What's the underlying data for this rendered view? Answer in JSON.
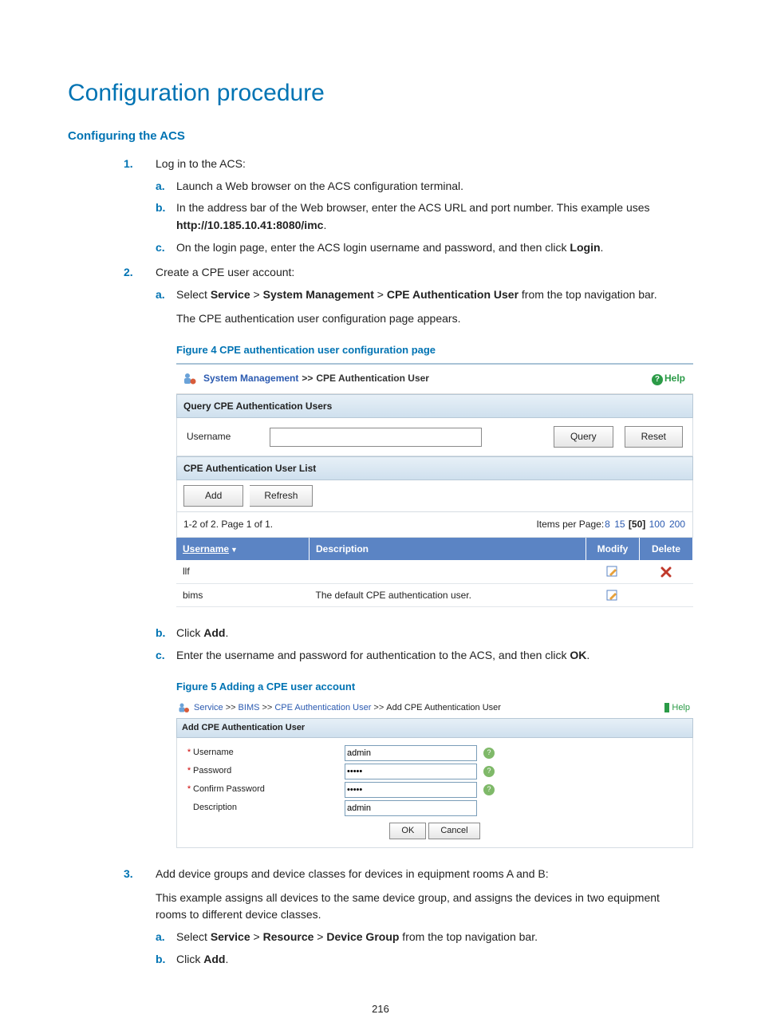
{
  "title": "Configuration procedure",
  "section1": "Configuring the ACS",
  "step1": {
    "num": "1.",
    "text": "Log in to the ACS:",
    "a": {
      "sub": "a.",
      "text": "Launch a Web browser on the ACS configuration terminal."
    },
    "b": {
      "sub": "b.",
      "pre": "In the address bar of the Web browser, enter the ACS URL and port number. This example uses ",
      "bold": "http://10.185.10.41:8080/imc",
      "post": "."
    },
    "c": {
      "sub": "c.",
      "pre": "On the login page, enter the ACS login username and password, and then click ",
      "bold": "Login",
      "post": "."
    }
  },
  "step2": {
    "num": "2.",
    "text": "Create a CPE user account:",
    "a": {
      "sub": "a.",
      "pre": "Select ",
      "b1": "Service",
      "gt1": " > ",
      "b2": "System Management",
      "gt2": " > ",
      "b3": "CPE Authentication User",
      "post": " from the top navigation bar.",
      "after": "The CPE authentication user configuration page appears."
    },
    "fig4cap": "Figure 4 CPE authentication user configuration page",
    "b": {
      "sub": "b.",
      "pre": "Click ",
      "bold": "Add",
      "post": "."
    },
    "c": {
      "sub": "c.",
      "pre": "Enter the username and password for authentication to the ACS, and then click ",
      "bold": "OK",
      "post": "."
    },
    "fig5cap": "Figure 5 Adding a CPE user account"
  },
  "step3": {
    "num": "3.",
    "text": "Add device groups and device classes for devices in equipment rooms A and B:",
    "after": "This example assigns all devices to the same device group, and assigns the devices in two equipment rooms to different device classes.",
    "a": {
      "sub": "a.",
      "pre": "Select ",
      "b1": "Service",
      "gt1": " > ",
      "b2": "Resource",
      "gt2": " > ",
      "b3": "Device Group",
      "post": " from the top navigation bar."
    },
    "b": {
      "sub": "b.",
      "pre": "Click ",
      "bold": "Add",
      "post": "."
    }
  },
  "fig4": {
    "crumb1": "System Management",
    "sep": ">>",
    "crumb2": "CPE Authentication User",
    "help": "Help",
    "queryHead": "Query CPE Authentication Users",
    "usernameLabel": "Username",
    "queryBtn": "Query",
    "resetBtn": "Reset",
    "listHead": "CPE Authentication User List",
    "addBtn": "Add",
    "refreshBtn": "Refresh",
    "pager": "1-2 of 2. Page 1 of 1.",
    "ippLabel": "Items per Page:",
    "ipp": [
      "8",
      "15",
      "[50]",
      "100",
      "200"
    ],
    "cols": {
      "u": "Username",
      "d": "Description",
      "m": "Modify",
      "x": "Delete"
    },
    "rows": [
      {
        "u": "llf",
        "d": "",
        "del": true
      },
      {
        "u": "bims",
        "d": "The default CPE authentication user.",
        "del": false
      }
    ]
  },
  "fig5": {
    "crumbs": [
      "Service",
      "BIMS",
      "CPE Authentication User",
      "Add CPE Authentication User"
    ],
    "sep": ">>",
    "help": "Help",
    "head": "Add CPE Authentication User",
    "fields": {
      "username": {
        "label": "Username",
        "value": "admin",
        "req": true,
        "hint": true
      },
      "password": {
        "label": "Password",
        "value": "•••••",
        "req": true,
        "hint": true
      },
      "confirm": {
        "label": "Confirm Password",
        "value": "•••••",
        "req": true,
        "hint": true
      },
      "desc": {
        "label": "Description",
        "value": "admin",
        "req": false,
        "hint": false
      }
    },
    "ok": "OK",
    "cancel": "Cancel"
  },
  "pageNumber": "216"
}
